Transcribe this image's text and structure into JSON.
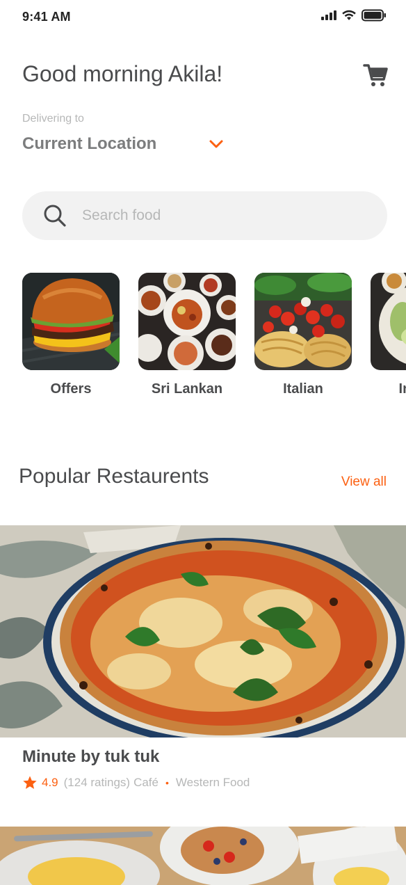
{
  "status_bar": {
    "time": "9:41 AM"
  },
  "header": {
    "greeting": "Good morning Akila!",
    "cart_icon": "cart-icon"
  },
  "delivery": {
    "label": "Delivering to",
    "location": "Current Location"
  },
  "search": {
    "placeholder": "Search food"
  },
  "categories": [
    {
      "label": "Offers"
    },
    {
      "label": "Sri Lankan"
    },
    {
      "label": "Italian"
    },
    {
      "label": "Indian"
    }
  ],
  "popular": {
    "title": "Popular Restaurents",
    "view_all": "View all",
    "restaurants": [
      {
        "name": "Minute by tuk tuk",
        "rating": "4.9",
        "ratings_count": "(124 ratings)",
        "type": "Café",
        "cuisine": "Western Food"
      }
    ]
  },
  "colors": {
    "accent": "#fc6011",
    "primary_text": "#4a4b4d",
    "secondary_text": "#b6b7b7",
    "search_bg": "#f2f2f2"
  }
}
